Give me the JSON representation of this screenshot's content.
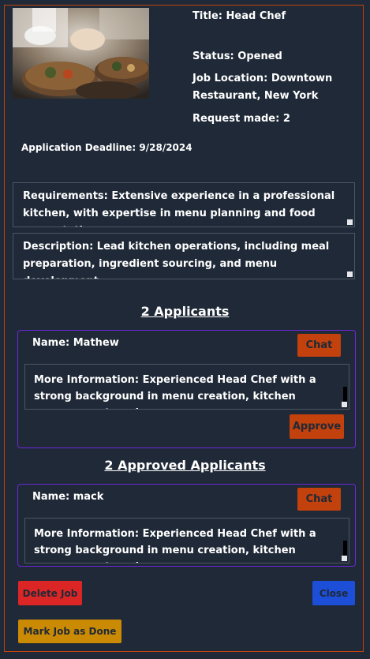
{
  "job": {
    "title": "Title: Head Chef",
    "status": "Status: Opened",
    "location": "Job Location: Downtown Restaurant, New York",
    "requests": "Request made: 2",
    "deadline": "Application Deadline: 9/28/2024",
    "requirements": "Requirements: Extensive experience in a professional kitchen, with expertise in menu planning and food presentation.",
    "description": "Description: Lead kitchen operations, including meal preparation, ingredient sourcing, and menu development."
  },
  "applicants": {
    "heading": "2 Applicants",
    "items": [
      {
        "name": "Name: Mathew",
        "chat_label": "Chat",
        "info": "More Information: Experienced Head Chef with a strong background in menu creation, kitchen management, and",
        "approve_label": "Approve"
      }
    ]
  },
  "approved": {
    "heading": "2 Approved Applicants",
    "items": [
      {
        "name": "Name: mack",
        "chat_label": "Chat",
        "info": "More Information: Experienced Head Chef with a strong background in menu creation, kitchen management, and"
      }
    ]
  },
  "actions": {
    "delete_label": "Delete Job",
    "close_label": "Close",
    "done_label": "Mark Job as Done"
  },
  "colors": {
    "accent": "#c2410c",
    "danger": "#dc2626",
    "primary": "#1d4ed8",
    "done": "#ca8a04",
    "card_border": "#6d28d9",
    "background": "#1f2937"
  }
}
